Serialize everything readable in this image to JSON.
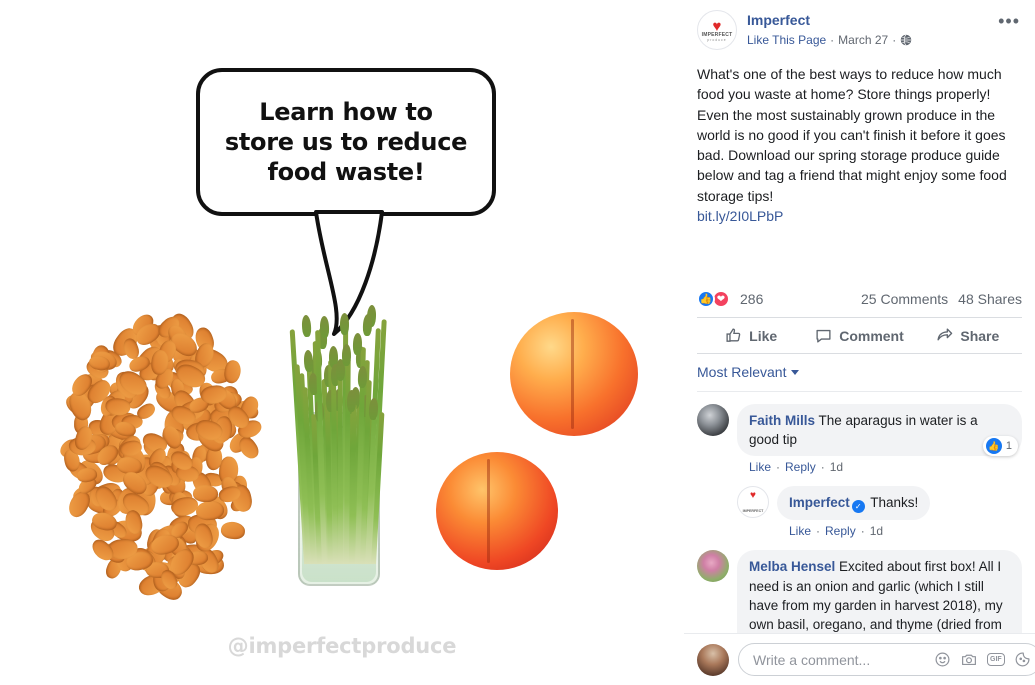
{
  "post": {
    "page_name": "Imperfect",
    "like_page_label": "Like This Page",
    "date": "March 27",
    "privacy_icon": "globe-icon",
    "more_icon": "ellipsis-icon",
    "avatar_heart": "♥",
    "avatar_label": "IMPERFECT",
    "avatar_sublabel": "produce",
    "body": "What's one of the best ways to reduce how much food you waste at home? Store things properly! Even the most sustainably grown produce in the world is no good if you can't finish it before it goes bad. Download our spring storage produce guide below and tag a friend that might enjoy some food storage tips!",
    "link": "bit.ly/2I0LPbP",
    "reaction_count": "286",
    "comments_count": "25 Comments",
    "shares_count": "48 Shares",
    "reaction_icons": [
      "like-icon",
      "love-icon"
    ]
  },
  "actions": {
    "like": "Like",
    "comment": "Comment",
    "share": "Share"
  },
  "sort": {
    "label": "Most Relevant"
  },
  "comments": [
    {
      "author": "Faith Mills",
      "text": " The aparagus in water is a good tip",
      "like": "Like",
      "reply": "Reply",
      "time": "1d",
      "badge_count": "1",
      "verified": false
    },
    {
      "author": "Imperfect",
      "text": " Thanks!",
      "like": "Like",
      "reply": "Reply",
      "time": "1d",
      "verified": true
    },
    {
      "author": "Melba Hensel",
      "text": " Excited about first box! All I need is an onion and garlic (which I still have from my garden in harvest 2018), my own basil, oregano, and thyme (dried from my own garden) , and a can of diced tomatoes for ratatouille!",
      "verified": false
    }
  ],
  "composer": {
    "placeholder": "Write a comment...",
    "icons": [
      "emoji-icon",
      "camera-icon",
      "gif-icon",
      "sticker-icon"
    ],
    "gif_label": "GIF"
  },
  "media": {
    "bubble_line1": "Learn how to",
    "bubble_line2": "store us to reduce",
    "bubble_line3": "food waste!",
    "watermark": "@imperfectproduce"
  },
  "colors": {
    "fb_blue": "#385898",
    "like_blue": "#1778f2",
    "love_red": "#f3425f",
    "text_dark": "#1c1e21",
    "text_muted": "#606770"
  }
}
